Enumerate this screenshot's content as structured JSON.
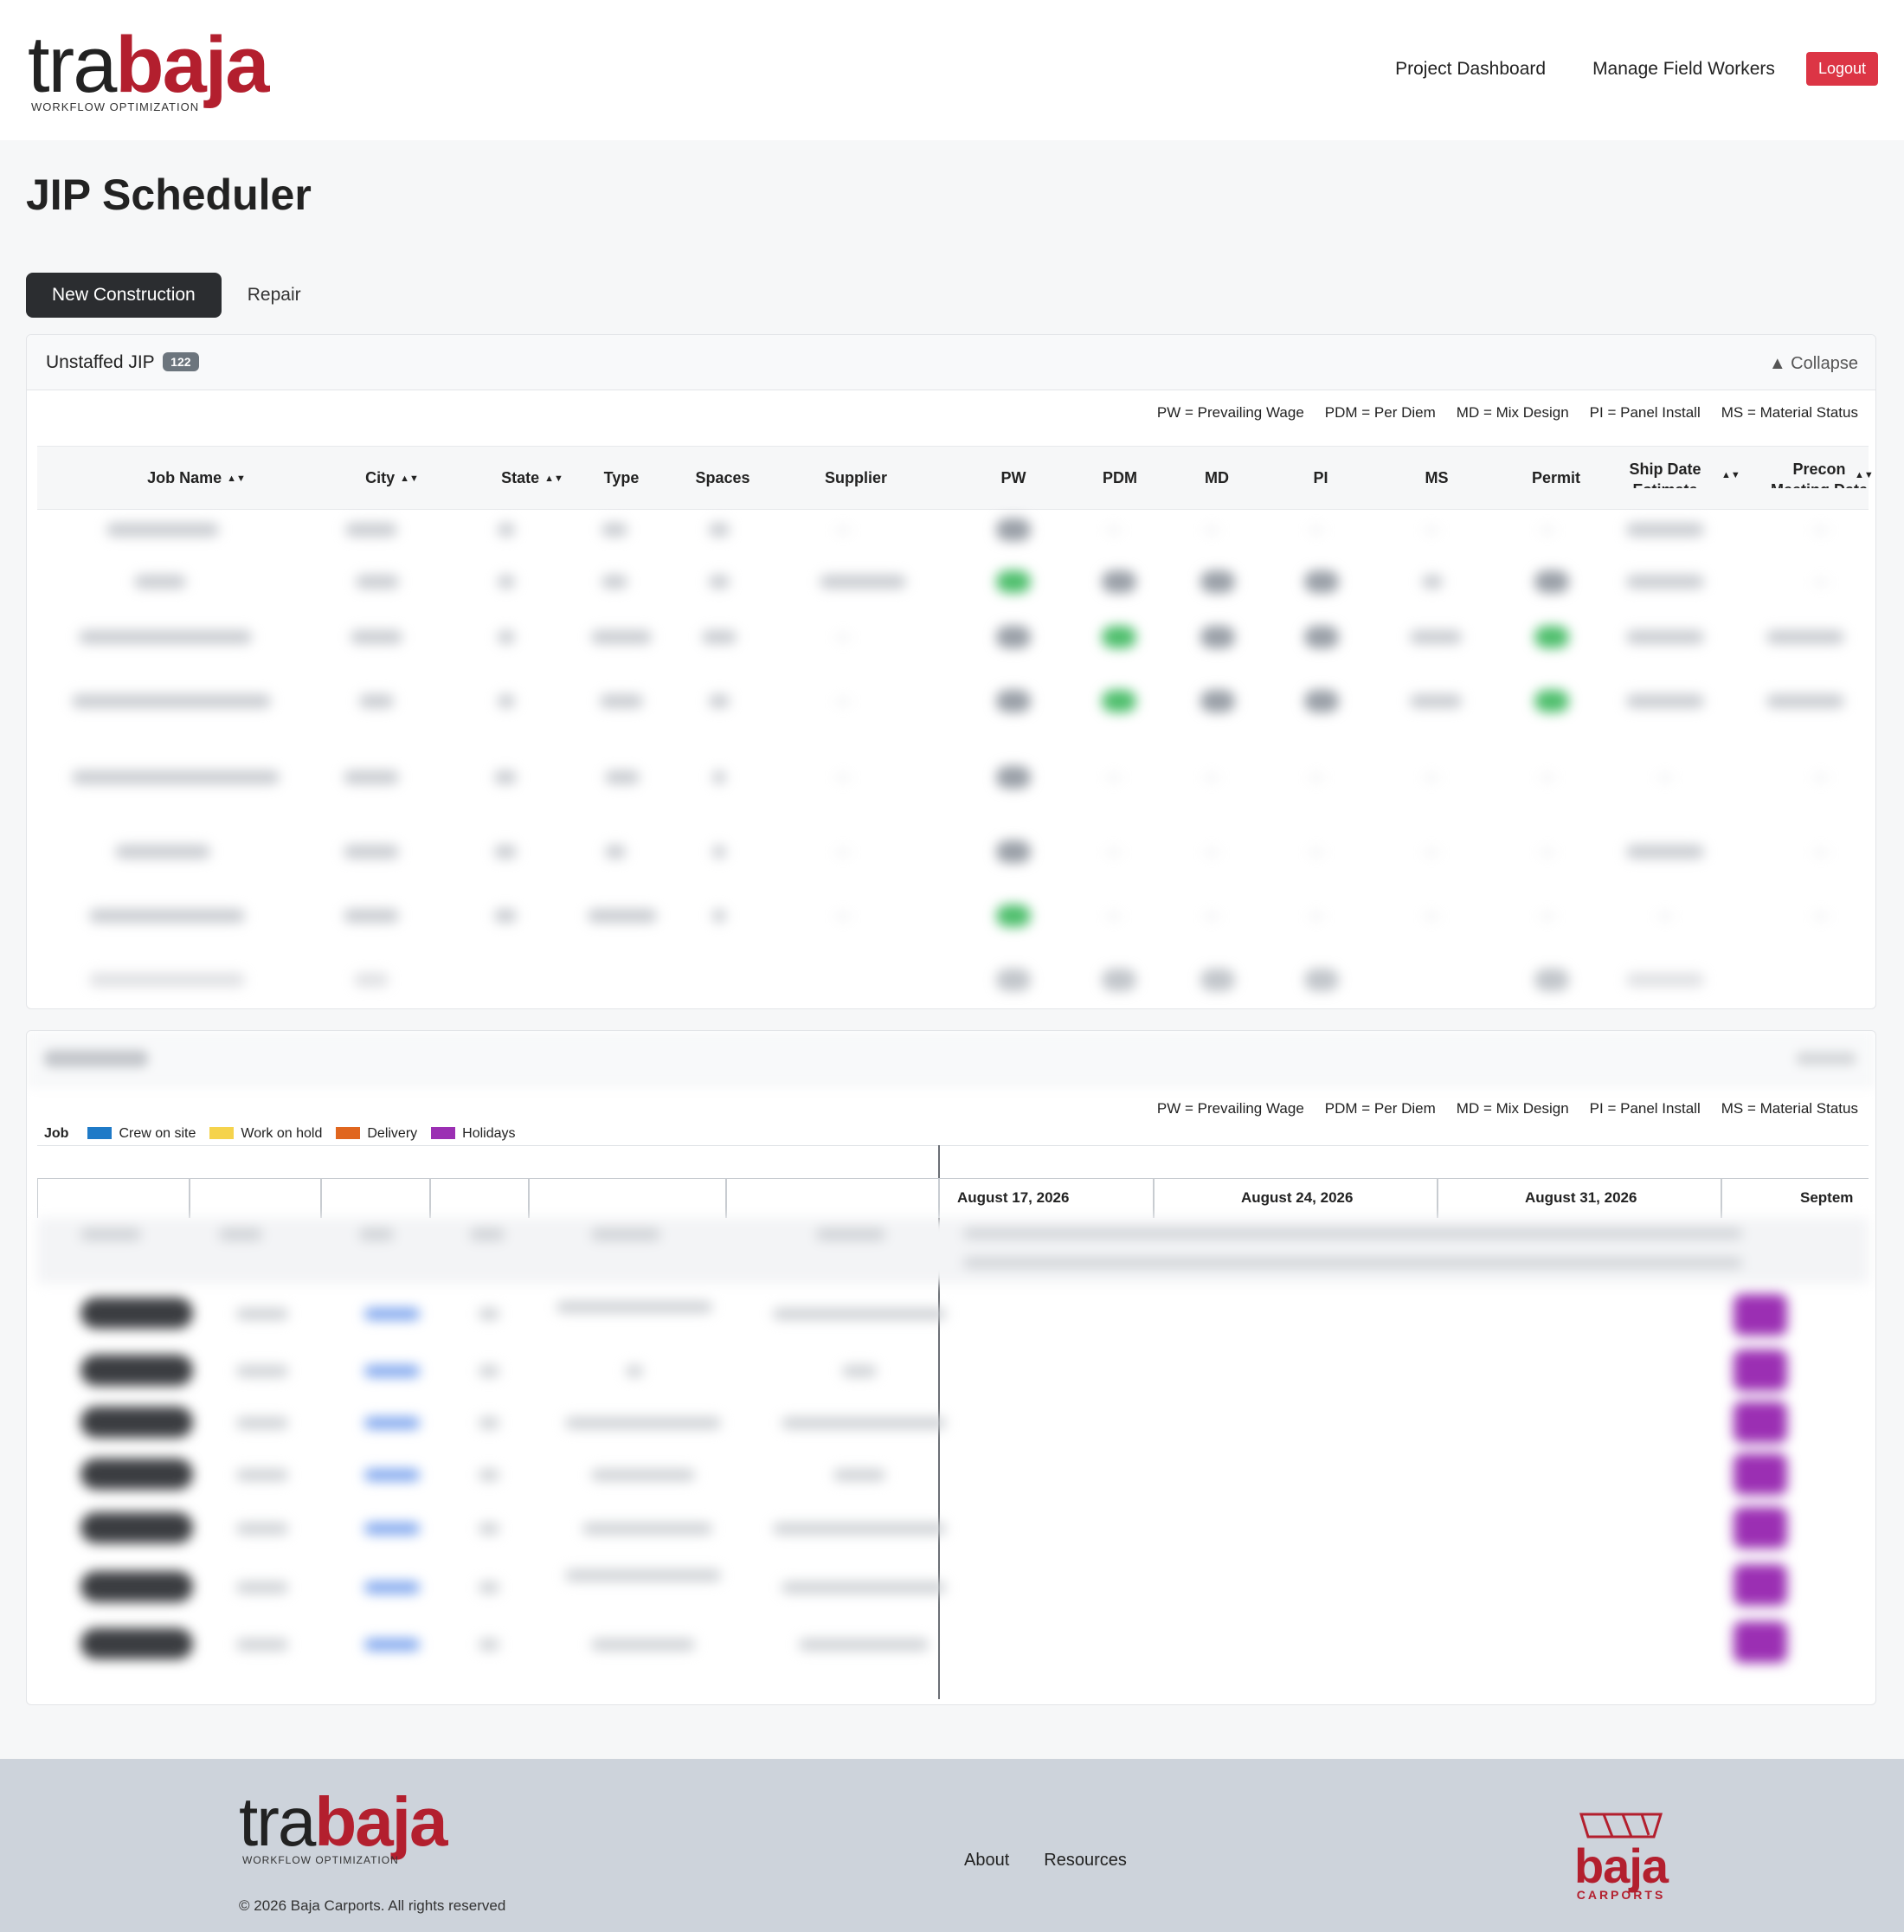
{
  "header": {
    "logo": {
      "tra": "tra",
      "baja": "baja",
      "tagline": "WORKFLOW OPTIMIZATION"
    },
    "nav": [
      {
        "label": "Project Dashboard"
      },
      {
        "label": "Manage Field Workers"
      }
    ],
    "logout_label": "Logout"
  },
  "page": {
    "title": "JIP Scheduler",
    "tabs": [
      {
        "label": "New Construction",
        "active": true
      },
      {
        "label": "Repair",
        "active": false
      }
    ]
  },
  "unstaffed": {
    "title": "Unstaffed JIP",
    "count": "122",
    "collapse_label": "▲ Collapse",
    "legend": [
      "PW = Prevailing Wage",
      "PDM = Per Diem",
      "MD = Mix Design",
      "PI = Panel Install",
      "MS = Material Status"
    ],
    "columns": [
      {
        "label": "Job Name",
        "sortable": true
      },
      {
        "label": "City",
        "sortable": true
      },
      {
        "label": "State",
        "sortable": true
      },
      {
        "label": "Type",
        "sortable": false
      },
      {
        "label": "Spaces",
        "sortable": false
      },
      {
        "label": "Supplier",
        "sortable": false
      },
      {
        "label": "PW",
        "sortable": false
      },
      {
        "label": "PDM",
        "sortable": false
      },
      {
        "label": "MD",
        "sortable": false
      },
      {
        "label": "PI",
        "sortable": false
      },
      {
        "label": "MS",
        "sortable": false
      },
      {
        "label": "Permit",
        "sortable": false
      },
      {
        "label": "Ship Date Estimate",
        "sortable": true
      },
      {
        "label": "Precon Meeting Date",
        "sortable": true
      }
    ]
  },
  "staffed": {
    "legend": [
      "PW = Prevailing Wage",
      "PDM = Per Diem",
      "MD = Mix Design",
      "PI = Panel Install",
      "MS = Material Status"
    ],
    "key_label": "Job",
    "key": [
      {
        "label": "Crew on site",
        "color": "#1f7ac7"
      },
      {
        "label": "Work on hold",
        "color": "#f5d34c"
      },
      {
        "label": "Delivery",
        "color": "#e0661f"
      },
      {
        "label": "Holidays",
        "color": "#9b2fb3"
      }
    ],
    "weeks": [
      "August 17, 2026",
      "August 24, 2026",
      "August 31, 2026",
      "Septem"
    ]
  },
  "footer": {
    "logo": {
      "tra": "tra",
      "baja": "baja",
      "tagline": "WORKFLOW OPTIMIZATION"
    },
    "copyright": "© 2026 Baja Carports. All rights reserved",
    "links": [
      {
        "label": "About"
      },
      {
        "label": "Resources"
      }
    ],
    "brand": {
      "word": "baja",
      "sub": "CARPORTS"
    }
  },
  "colors": {
    "brand_red": "#b31f2e",
    "logout_red": "#dc3545",
    "active_tab": "#2b2d30",
    "status_green": "#4fbf6d",
    "holiday_purple": "#9b2fb3"
  }
}
